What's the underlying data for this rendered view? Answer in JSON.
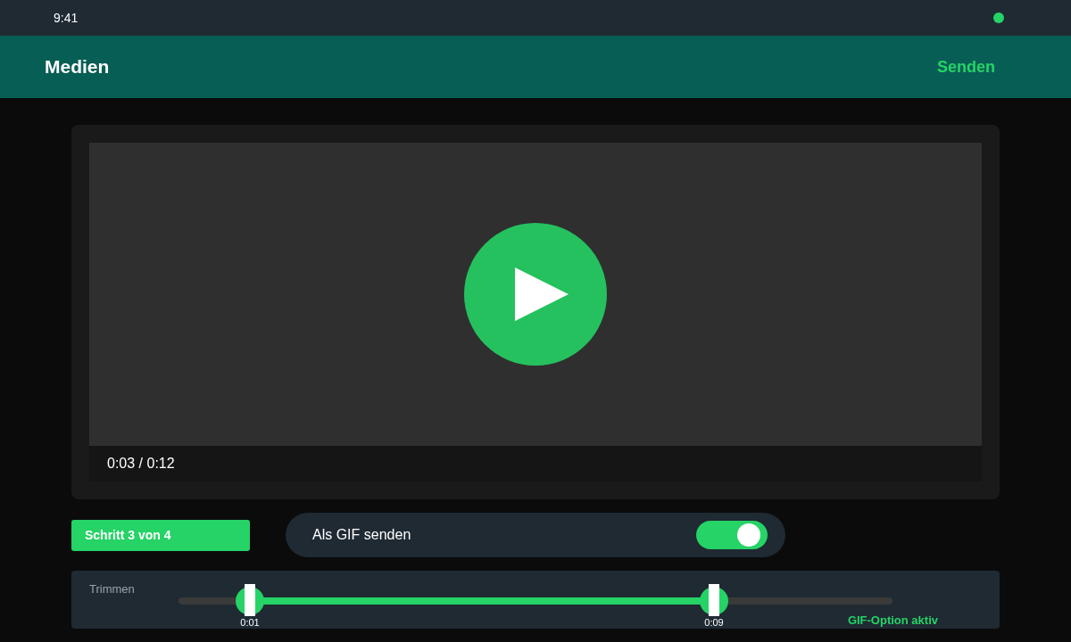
{
  "status_bar": {
    "time": "9:41"
  },
  "header": {
    "title": "Medien",
    "action": "Senden"
  },
  "video": {
    "time": "0:03 / 0:12"
  },
  "step": "Schritt 3 von 4",
  "gif_toggle": {
    "label": "Als GIF senden",
    "on": true
  },
  "trim": {
    "label": "Trimmen",
    "start": {
      "level": 0.1,
      "reading": "0:01"
    },
    "end": {
      "level": 0.75,
      "reading": "0:09"
    },
    "status": "GIF-Option aktiv"
  }
}
